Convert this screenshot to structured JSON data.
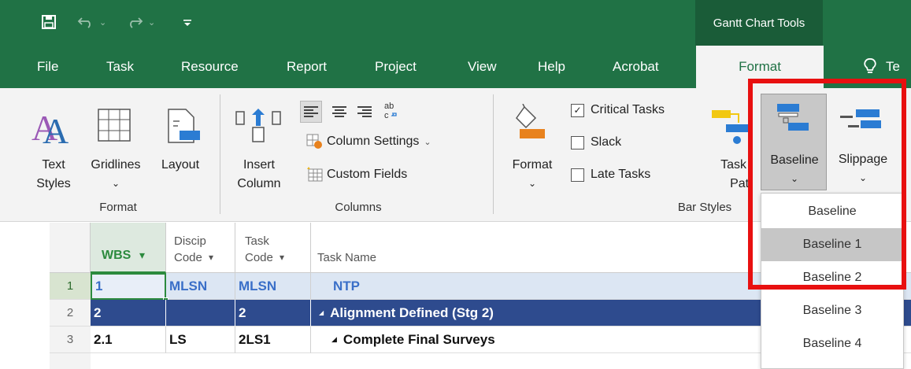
{
  "colors": {
    "brand": "#207245",
    "accent_red": "#e81010",
    "selection_blue": "#2e4b8e",
    "wbs_green": "#2c8a3e",
    "milestone_blue": "#3a6fc8"
  },
  "qat": {
    "save_icon": "save-icon",
    "undo_icon": "undo-icon",
    "redo_icon": "redo-icon",
    "customize_icon": "customize-icon"
  },
  "contextual_tab": "Gantt Chart Tools",
  "tabs": [
    {
      "label": "File"
    },
    {
      "label": "Task"
    },
    {
      "label": "Resource"
    },
    {
      "label": "Report"
    },
    {
      "label": "Project"
    },
    {
      "label": "View"
    },
    {
      "label": "Help"
    },
    {
      "label": "Acrobat"
    },
    {
      "label": "Format"
    },
    {
      "label": "Te"
    }
  ],
  "ribbon": {
    "format_group": {
      "label": "Format",
      "text_styles": "Text\nStyles",
      "text_styles_l1": "Text",
      "text_styles_l2": "Styles",
      "gridlines": "Gridlines",
      "layout": "Layout",
      "dropdown_glyph": "⌄"
    },
    "columns_group": {
      "label": "Columns",
      "insert_l1": "Insert",
      "insert_l2": "Column",
      "column_settings": "Column Settings",
      "custom_fields": "Custom Fields"
    },
    "bar_styles_group": {
      "label": "Bar Styles",
      "format": "Format",
      "critical_tasks": "Critical Tasks",
      "critical_checked": true,
      "slack": "Slack",
      "late_tasks": "Late Tasks",
      "task_path_l1": "Task",
      "task_path_l2": "Path",
      "baseline": "Baseline",
      "slippage": "Slippage"
    }
  },
  "grid": {
    "headers": {
      "wbs": "WBS",
      "disc_l1": "Discip",
      "disc_l2": "Code",
      "task_l1": "Task",
      "task_l2": "Code",
      "task_name": "Task Name",
      "sort_glyph": "▾"
    },
    "rows": [
      {
        "num": "1",
        "wbs": "1",
        "disc": "MLSN",
        "code": "MLSN",
        "name": "NTP"
      },
      {
        "num": "2",
        "wbs": "2",
        "disc": "",
        "code": "2",
        "name": "Alignment Defined (Stg 2)",
        "expand": "◢"
      },
      {
        "num": "3",
        "wbs": "2.1",
        "disc": "LS",
        "code": "2LS1",
        "name": "Complete Final Surveys",
        "expand": "◢"
      }
    ]
  },
  "dropdown": {
    "items": [
      "Baseline",
      "Baseline 1",
      "Baseline 2",
      "Baseline 3",
      "Baseline 4"
    ],
    "highlighted_index": 1
  }
}
